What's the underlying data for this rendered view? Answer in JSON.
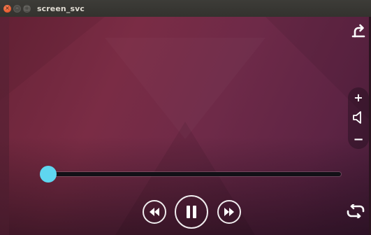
{
  "window": {
    "title": "screen_svc",
    "close_glyph": "×",
    "min_glyph": "–",
    "max_glyph": "□"
  },
  "player": {
    "seek_progress": 0.02,
    "accent_color": "#5fd6f0",
    "volume": {
      "increase_label": "+",
      "decrease_label": "−"
    },
    "icons": {
      "rotate": "rotate-right-icon",
      "volume": "speaker-icon",
      "rewind": "rewind-icon",
      "pause": "pause-icon",
      "fast_forward": "fast-forward-icon",
      "repeat": "repeat-icon"
    }
  }
}
